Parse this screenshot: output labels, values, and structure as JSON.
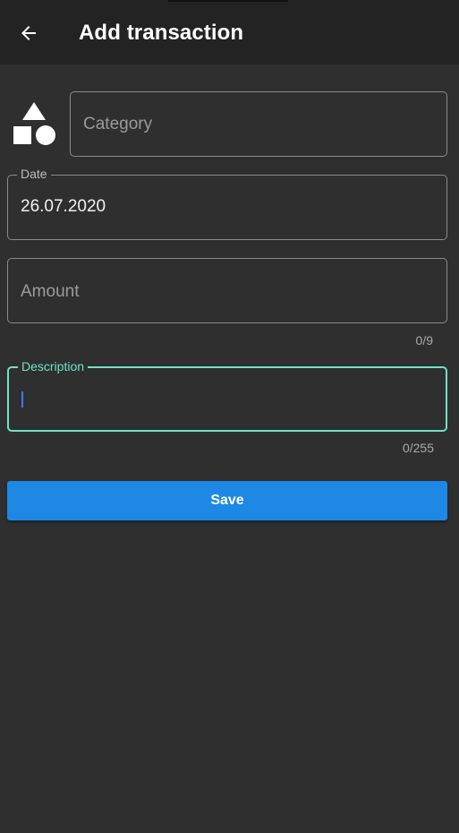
{
  "appbar": {
    "title": "Add transaction",
    "back_icon": "arrow-left-icon"
  },
  "form": {
    "category": {
      "placeholder": "Category",
      "icon": "shapes-icon"
    },
    "date": {
      "label": "Date",
      "value": "26.07.2020"
    },
    "amount": {
      "placeholder": "Amount",
      "counter": "0/9"
    },
    "description": {
      "label": "Description",
      "counter": "0/255",
      "focused": true
    },
    "save_label": "Save"
  },
  "colors": {
    "background": "#2f2f2f",
    "appbar": "#232323",
    "accent_focus": "#6fe3c3",
    "primary_button": "#1e88e5",
    "caret": "#3d7bff"
  }
}
